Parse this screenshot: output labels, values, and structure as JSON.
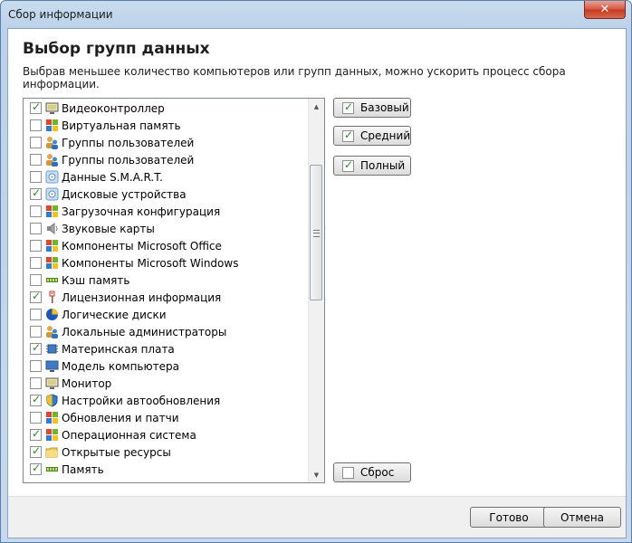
{
  "window": {
    "title": "Сбор информации",
    "close_glyph": "✕"
  },
  "header": {
    "title": "Выбор групп данных",
    "description": "Выбрав меньшее количество компьютеров или групп данных, можно ускорить процесс сбора информации."
  },
  "list": {
    "items": [
      {
        "label": "Видеоконтроллер",
        "checked": true,
        "icon": "monitor-icon"
      },
      {
        "label": "Виртуальная память",
        "checked": false,
        "icon": "windows-icon"
      },
      {
        "label": "Группы пользователей",
        "checked": false,
        "icon": "users-icon"
      },
      {
        "label": "Группы пользователей",
        "checked": false,
        "icon": "users-icon"
      },
      {
        "label": "Данные S.M.A.R.T.",
        "checked": false,
        "icon": "disk-icon"
      },
      {
        "label": "Дисковые устройства",
        "checked": true,
        "icon": "disk-icon"
      },
      {
        "label": "Загрузочная конфигурация",
        "checked": false,
        "icon": "windows-icon"
      },
      {
        "label": "Звуковые карты",
        "checked": false,
        "icon": "speaker-icon"
      },
      {
        "label": "Компоненты Microsoft Office",
        "checked": false,
        "icon": "windows-icon"
      },
      {
        "label": "Компоненты Microsoft Windows",
        "checked": false,
        "icon": "windows-icon"
      },
      {
        "label": "Кэш память",
        "checked": false,
        "icon": "memory-icon"
      },
      {
        "label": "Лицензионная информация",
        "checked": true,
        "icon": "license-icon"
      },
      {
        "label": "Логические диски",
        "checked": false,
        "icon": "pie-icon"
      },
      {
        "label": "Локальные администраторы",
        "checked": false,
        "icon": "users-icon"
      },
      {
        "label": "Материнская плата",
        "checked": true,
        "icon": "chip-icon"
      },
      {
        "label": "Модель компьютера",
        "checked": false,
        "icon": "computer-icon"
      },
      {
        "label": "Монитор",
        "checked": false,
        "icon": "monitor-icon"
      },
      {
        "label": "Настройки автообновления",
        "checked": true,
        "icon": "shield-icon"
      },
      {
        "label": "Обновления и патчи",
        "checked": false,
        "icon": "windows-icon"
      },
      {
        "label": "Операционная система",
        "checked": true,
        "icon": "windows-icon"
      },
      {
        "label": "Открытые ресурсы",
        "checked": true,
        "icon": "folder-icon"
      },
      {
        "label": "Память",
        "checked": true,
        "icon": "memory-icon"
      }
    ]
  },
  "presets": {
    "basic": {
      "label": "Базовый",
      "checked": true
    },
    "medium": {
      "label": "Средний",
      "checked": true
    },
    "full": {
      "label": "Полный",
      "checked": true
    },
    "reset": {
      "label": "Сброс",
      "checked": false
    }
  },
  "footer": {
    "ok": "Готово",
    "cancel": "Отмена"
  },
  "colors": {
    "check": "#2c8a2c",
    "titlebar": "#c9dcef",
    "close": "#c4391f"
  }
}
